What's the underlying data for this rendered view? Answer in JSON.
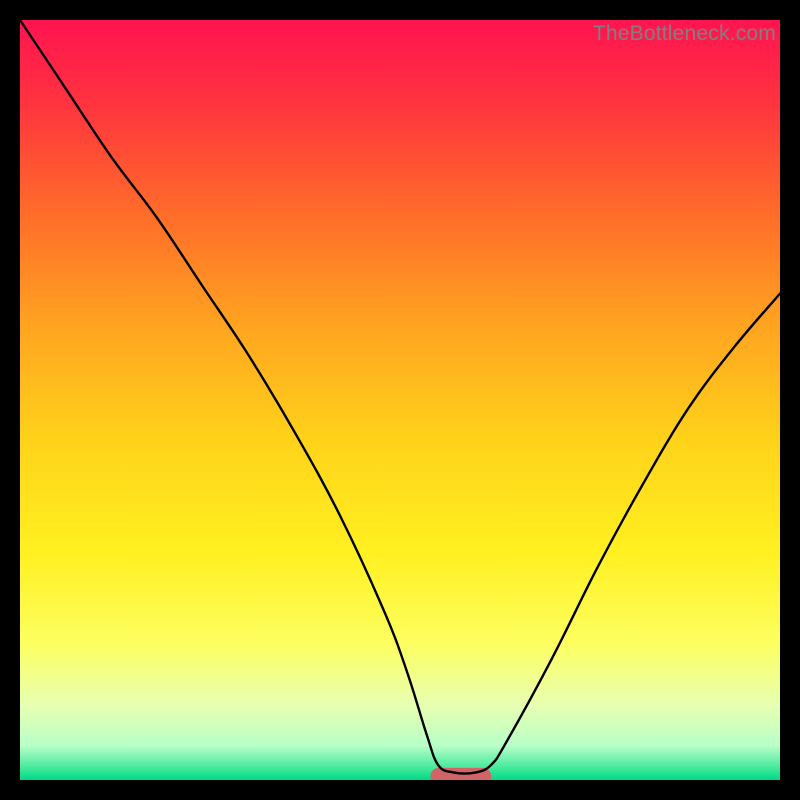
{
  "watermark": "TheBottleneck.com",
  "chart_data": {
    "type": "line",
    "title": "",
    "xlabel": "",
    "ylabel": "",
    "xlim": [
      0,
      100
    ],
    "ylim": [
      0,
      100
    ],
    "grid": false,
    "legend": false,
    "background": {
      "type": "vertical-gradient",
      "stops": [
        {
          "offset": 0.0,
          "color": "#ff1450"
        },
        {
          "offset": 0.1,
          "color": "#ff3040"
        },
        {
          "offset": 0.25,
          "color": "#ff6a2a"
        },
        {
          "offset": 0.4,
          "color": "#ffa320"
        },
        {
          "offset": 0.55,
          "color": "#ffd21a"
        },
        {
          "offset": 0.7,
          "color": "#fff020"
        },
        {
          "offset": 0.82,
          "color": "#fdff60"
        },
        {
          "offset": 0.9,
          "color": "#e8ffb0"
        },
        {
          "offset": 0.955,
          "color": "#b8ffc8"
        },
        {
          "offset": 0.985,
          "color": "#40e89a"
        },
        {
          "offset": 1.0,
          "color": "#00d988"
        }
      ]
    },
    "series": [
      {
        "name": "bottleneck-curve",
        "stroke": "#000000",
        "stroke_width": 2.4,
        "x": [
          0,
          6,
          12,
          18,
          24,
          30,
          36,
          42,
          48,
          51,
          53.5,
          55,
          57,
          60,
          62,
          64,
          70,
          76,
          82,
          88,
          94,
          100
        ],
        "values": [
          100,
          91,
          82,
          74,
          65,
          56,
          46,
          35,
          22,
          14,
          6,
          2,
          1,
          1,
          2,
          5,
          16,
          28,
          39,
          49,
          57,
          64
        ]
      }
    ],
    "markers": [
      {
        "name": "valley-marker",
        "shape": "rounded-rect",
        "fill": "#d16565",
        "cx": 58.0,
        "cy": 0.5,
        "width": 8.0,
        "height": 2.2,
        "rx": 1.1
      }
    ]
  }
}
